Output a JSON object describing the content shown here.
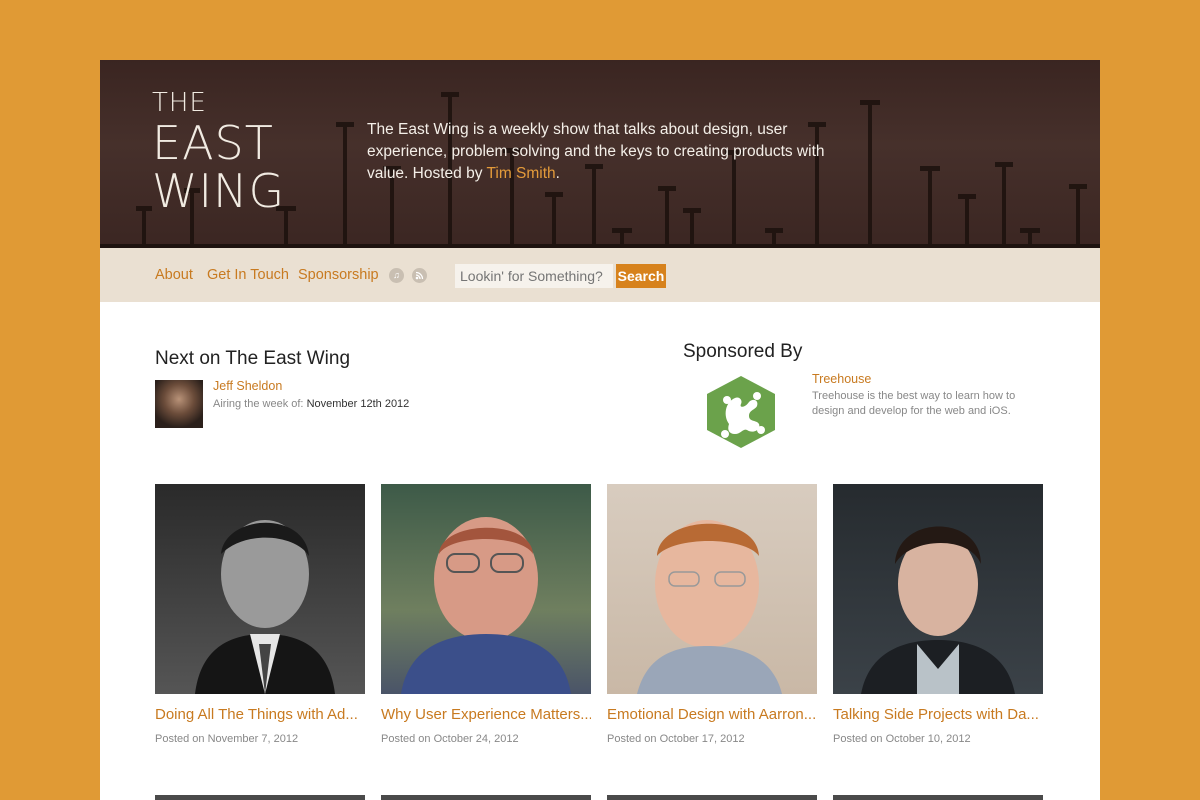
{
  "logo": {
    "line1": "THE",
    "line2": "EAST",
    "line3": "WING"
  },
  "tagline": {
    "text": "The East Wing is a weekly show that talks about design, user experience, problem solving and the keys to creating products with value. Hosted by ",
    "host": "Tim Smith",
    "end": "."
  },
  "nav": {
    "items": [
      {
        "label": "About"
      },
      {
        "label": "Get In Touch"
      },
      {
        "label": "Sponsorship"
      }
    ],
    "icons": [
      "music-note-icon",
      "rss-icon"
    ],
    "search_placeholder": "Lookin' for Something?",
    "search_button": "Search"
  },
  "next": {
    "heading": "Next on The East Wing",
    "guest": "Jeff Sheldon",
    "airing_label": "Airing the week of:",
    "airing_date": "November 12th 2012"
  },
  "sponsor": {
    "heading": "Sponsored By",
    "name": "Treehouse",
    "description": "Treehouse is the best way to learn how to design and develop for the web and iOS."
  },
  "episodes": [
    {
      "title": "Doing All The Things with Ad...",
      "date": "Posted on November 7, 2012"
    },
    {
      "title": "Why User Experience Matters...",
      "date": "Posted on October 24, 2012"
    },
    {
      "title": "Emotional Design with Aarron...",
      "date": "Posted on October 17, 2012"
    },
    {
      "title": "Talking Side Projects with Da...",
      "date": "Posted on October 10, 2012"
    }
  ],
  "colors": {
    "background": "#e09a35",
    "accent": "#c87a20",
    "button": "#d7821c",
    "header": "#3f2925",
    "navbar": "#eae0d2",
    "treehouse": "#6ba24b"
  }
}
